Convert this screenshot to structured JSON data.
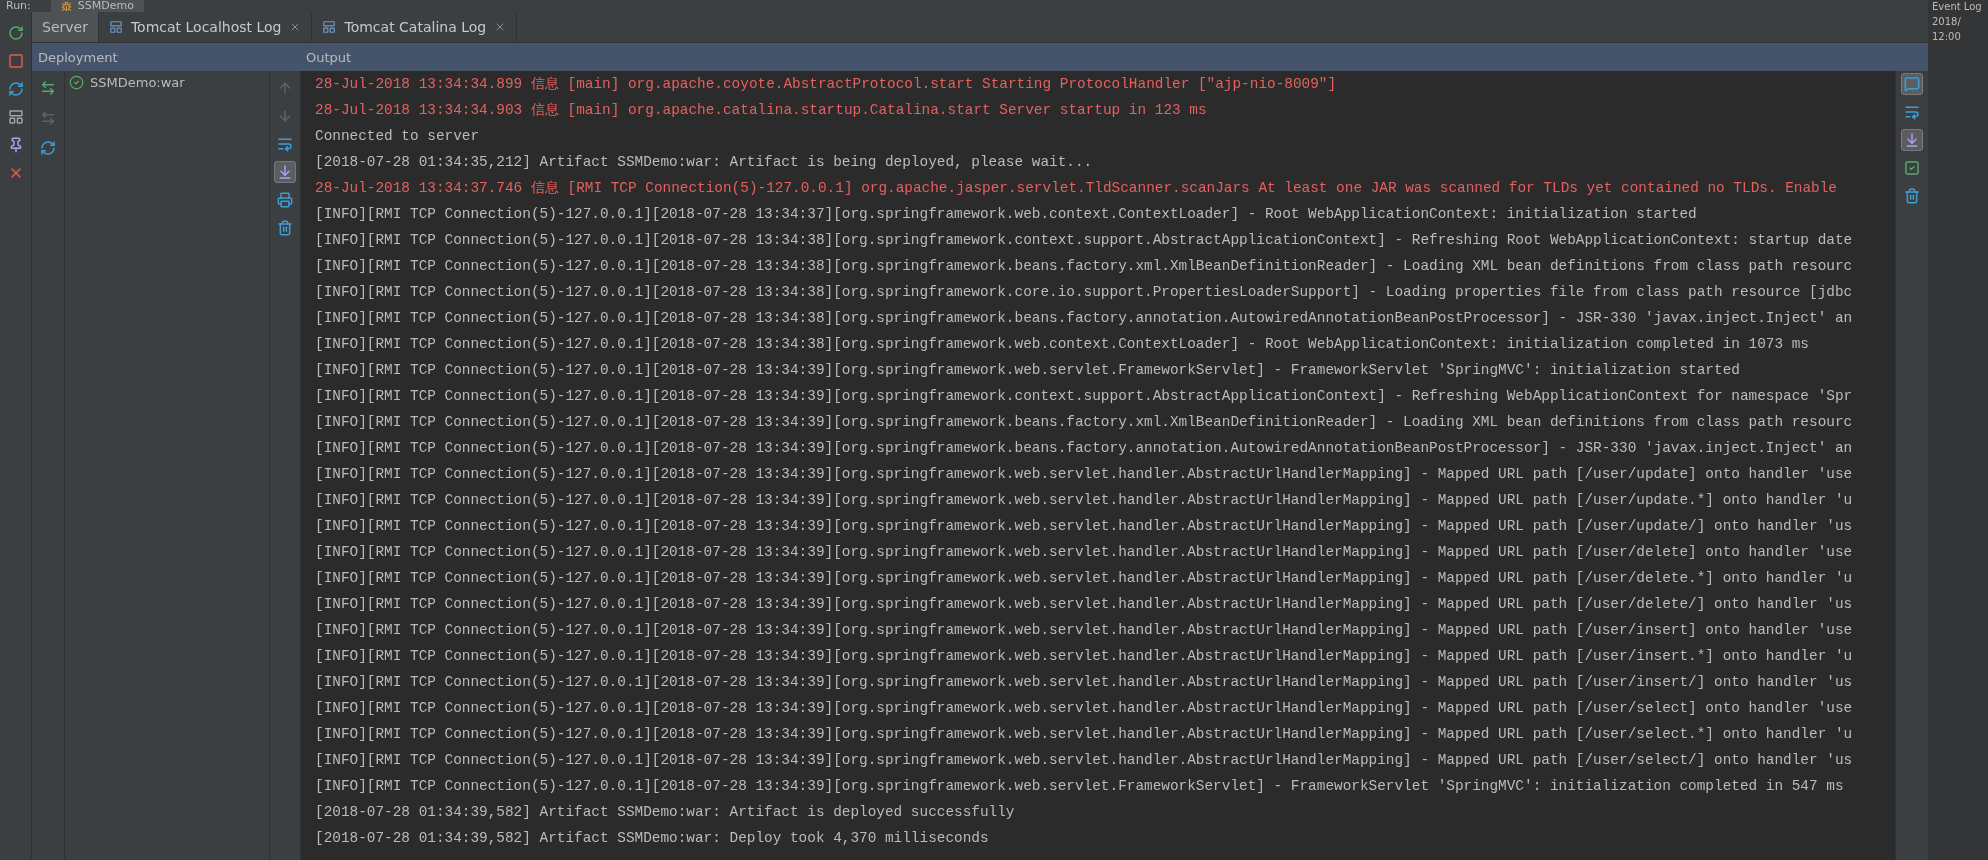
{
  "run_bar": {
    "label": "Run:",
    "tab": "SSMDemo"
  },
  "left_toolbar": [
    {
      "kind": "rerun",
      "disabled": false
    },
    {
      "kind": "stop",
      "disabled": false
    },
    {
      "kind": "update",
      "disabled": false
    },
    {
      "kind": "layout",
      "disabled": false
    },
    {
      "kind": "pin",
      "disabled": false
    },
    {
      "kind": "close",
      "disabled": false
    }
  ],
  "tabs": [
    {
      "label": "Server",
      "selected": true,
      "closable": false
    },
    {
      "label": "Tomcat Localhost Log",
      "selected": false,
      "closable": true
    },
    {
      "label": "Tomcat Catalina Log",
      "selected": false,
      "closable": true
    }
  ],
  "deployment": {
    "title": "Deployment",
    "toolbar": [
      {
        "kind": "deploy",
        "disabled": false
      },
      {
        "kind": "undeploy",
        "disabled": true
      },
      {
        "kind": "refresh",
        "disabled": false
      }
    ],
    "items": [
      {
        "label": "SSMDemo:war",
        "deployed": true
      }
    ]
  },
  "output": {
    "title": "Output",
    "toolbar": [
      {
        "kind": "up",
        "selected": false,
        "disabled": true
      },
      {
        "kind": "down",
        "selected": false,
        "disabled": true
      },
      {
        "kind": "wrap",
        "selected": false,
        "disabled": false
      },
      {
        "kind": "scroll_end",
        "selected": true,
        "disabled": false
      },
      {
        "kind": "print",
        "selected": false,
        "disabled": false
      },
      {
        "kind": "clear",
        "selected": false,
        "disabled": false
      }
    ],
    "lines": [
      {
        "kind": "error",
        "text": "28-Jul-2018 13:34:34.899 信息 [main] org.apache.coyote.AbstractProtocol.start Starting ProtocolHandler [\"ajp-nio-8009\"]"
      },
      {
        "kind": "error",
        "text": "28-Jul-2018 13:34:34.903 信息 [main] org.apache.catalina.startup.Catalina.start Server startup in 123 ms"
      },
      {
        "kind": "plain",
        "text": "Connected to server"
      },
      {
        "kind": "plain",
        "text": "[2018-07-28 01:34:35,212] Artifact SSMDemo:war: Artifact is being deployed, please wait..."
      },
      {
        "kind": "error",
        "text": "28-Jul-2018 13:34:37.746 信息 [RMI TCP Connection(5)-127.0.0.1] org.apache.jasper.servlet.TldScanner.scanJars At least one JAR was scanned for TLDs yet contained no TLDs. Enable"
      },
      {
        "kind": "plain",
        "text": "[INFO][RMI TCP Connection(5)-127.0.0.1][2018-07-28 13:34:37][org.springframework.web.context.ContextLoader] - Root WebApplicationContext: initialization started"
      },
      {
        "kind": "plain",
        "text": "[INFO][RMI TCP Connection(5)-127.0.0.1][2018-07-28 13:34:38][org.springframework.context.support.AbstractApplicationContext] - Refreshing Root WebApplicationContext: startup date"
      },
      {
        "kind": "plain",
        "text": "[INFO][RMI TCP Connection(5)-127.0.0.1][2018-07-28 13:34:38][org.springframework.beans.factory.xml.XmlBeanDefinitionReader] - Loading XML bean definitions from class path resourc"
      },
      {
        "kind": "plain",
        "text": "[INFO][RMI TCP Connection(5)-127.0.0.1][2018-07-28 13:34:38][org.springframework.core.io.support.PropertiesLoaderSupport] - Loading properties file from class path resource [jdbc"
      },
      {
        "kind": "plain",
        "text": "[INFO][RMI TCP Connection(5)-127.0.0.1][2018-07-28 13:34:38][org.springframework.beans.factory.annotation.AutowiredAnnotationBeanPostProcessor] - JSR-330 'javax.inject.Inject' an"
      },
      {
        "kind": "plain",
        "text": "[INFO][RMI TCP Connection(5)-127.0.0.1][2018-07-28 13:34:38][org.springframework.web.context.ContextLoader] - Root WebApplicationContext: initialization completed in 1073 ms"
      },
      {
        "kind": "plain",
        "text": "[INFO][RMI TCP Connection(5)-127.0.0.1][2018-07-28 13:34:39][org.springframework.web.servlet.FrameworkServlet] - FrameworkServlet 'SpringMVC': initialization started"
      },
      {
        "kind": "plain",
        "text": "[INFO][RMI TCP Connection(5)-127.0.0.1][2018-07-28 13:34:39][org.springframework.context.support.AbstractApplicationContext] - Refreshing WebApplicationContext for namespace 'Spr"
      },
      {
        "kind": "plain",
        "text": "[INFO][RMI TCP Connection(5)-127.0.0.1][2018-07-28 13:34:39][org.springframework.beans.factory.xml.XmlBeanDefinitionReader] - Loading XML bean definitions from class path resourc"
      },
      {
        "kind": "plain",
        "text": "[INFO][RMI TCP Connection(5)-127.0.0.1][2018-07-28 13:34:39][org.springframework.beans.factory.annotation.AutowiredAnnotationBeanPostProcessor] - JSR-330 'javax.inject.Inject' an"
      },
      {
        "kind": "plain",
        "text": "[INFO][RMI TCP Connection(5)-127.0.0.1][2018-07-28 13:34:39][org.springframework.web.servlet.handler.AbstractUrlHandlerMapping] - Mapped URL path [/user/update] onto handler 'use"
      },
      {
        "kind": "plain",
        "text": "[INFO][RMI TCP Connection(5)-127.0.0.1][2018-07-28 13:34:39][org.springframework.web.servlet.handler.AbstractUrlHandlerMapping] - Mapped URL path [/user/update.*] onto handler 'u"
      },
      {
        "kind": "plain",
        "text": "[INFO][RMI TCP Connection(5)-127.0.0.1][2018-07-28 13:34:39][org.springframework.web.servlet.handler.AbstractUrlHandlerMapping] - Mapped URL path [/user/update/] onto handler 'us"
      },
      {
        "kind": "plain",
        "text": "[INFO][RMI TCP Connection(5)-127.0.0.1][2018-07-28 13:34:39][org.springframework.web.servlet.handler.AbstractUrlHandlerMapping] - Mapped URL path [/user/delete] onto handler 'use"
      },
      {
        "kind": "plain",
        "text": "[INFO][RMI TCP Connection(5)-127.0.0.1][2018-07-28 13:34:39][org.springframework.web.servlet.handler.AbstractUrlHandlerMapping] - Mapped URL path [/user/delete.*] onto handler 'u"
      },
      {
        "kind": "plain",
        "text": "[INFO][RMI TCP Connection(5)-127.0.0.1][2018-07-28 13:34:39][org.springframework.web.servlet.handler.AbstractUrlHandlerMapping] - Mapped URL path [/user/delete/] onto handler 'us"
      },
      {
        "kind": "plain",
        "text": "[INFO][RMI TCP Connection(5)-127.0.0.1][2018-07-28 13:34:39][org.springframework.web.servlet.handler.AbstractUrlHandlerMapping] - Mapped URL path [/user/insert] onto handler 'use"
      },
      {
        "kind": "plain",
        "text": "[INFO][RMI TCP Connection(5)-127.0.0.1][2018-07-28 13:34:39][org.springframework.web.servlet.handler.AbstractUrlHandlerMapping] - Mapped URL path [/user/insert.*] onto handler 'u"
      },
      {
        "kind": "plain",
        "text": "[INFO][RMI TCP Connection(5)-127.0.0.1][2018-07-28 13:34:39][org.springframework.web.servlet.handler.AbstractUrlHandlerMapping] - Mapped URL path [/user/insert/] onto handler 'us"
      },
      {
        "kind": "plain",
        "text": "[INFO][RMI TCP Connection(5)-127.0.0.1][2018-07-28 13:34:39][org.springframework.web.servlet.handler.AbstractUrlHandlerMapping] - Mapped URL path [/user/select] onto handler 'use"
      },
      {
        "kind": "plain",
        "text": "[INFO][RMI TCP Connection(5)-127.0.0.1][2018-07-28 13:34:39][org.springframework.web.servlet.handler.AbstractUrlHandlerMapping] - Mapped URL path [/user/select.*] onto handler 'u"
      },
      {
        "kind": "plain",
        "text": "[INFO][RMI TCP Connection(5)-127.0.0.1][2018-07-28 13:34:39][org.springframework.web.servlet.handler.AbstractUrlHandlerMapping] - Mapped URL path [/user/select/] onto handler 'us"
      },
      {
        "kind": "plain",
        "text": "[INFO][RMI TCP Connection(5)-127.0.0.1][2018-07-28 13:34:39][org.springframework.web.servlet.FrameworkServlet] - FrameworkServlet 'SpringMVC': initialization completed in 547 ms"
      },
      {
        "kind": "plain",
        "text": "[2018-07-28 01:34:39,582] Artifact SSMDemo:war: Artifact is deployed successfully"
      },
      {
        "kind": "plain",
        "text": "[2018-07-28 01:34:39,582] Artifact SSMDemo:war: Deploy took 4,370 milliseconds"
      }
    ]
  },
  "right_toolbar": [
    {
      "kind": "chat",
      "selected": true
    },
    {
      "kind": "wrap",
      "selected": false
    },
    {
      "kind": "scroll_end",
      "selected": true
    },
    {
      "kind": "check",
      "selected": false
    },
    {
      "kind": "clear",
      "selected": false
    }
  ],
  "event_log": {
    "title": "Event Log",
    "date": "2018/",
    "time": "12:00"
  }
}
